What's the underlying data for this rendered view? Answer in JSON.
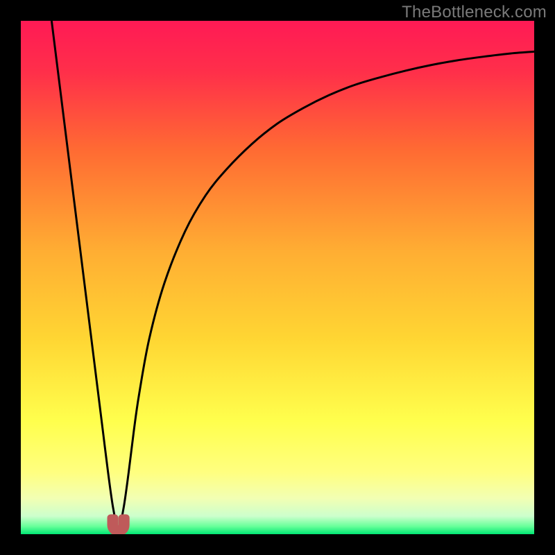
{
  "watermark": "TheBottleneck.com",
  "colors": {
    "frame": "#000000",
    "gradient_top": "#ff1a4d",
    "gradient_mid_upper": "#ff6a33",
    "gradient_mid": "#ffd633",
    "gradient_lower": "#ffff66",
    "gradient_pale": "#f2ffcc",
    "gradient_bottom": "#00e673",
    "curve": "#000000",
    "marker_fill": "#bf5a5a",
    "marker_stroke": "#bf5a5a"
  },
  "chart_data": {
    "type": "line",
    "title": "",
    "xlabel": "",
    "ylabel": "",
    "xlim": [
      0,
      100
    ],
    "ylim": [
      0,
      100
    ],
    "optimum_x": 19,
    "series": [
      {
        "name": "bottleneck-curve",
        "x": [
          6,
          8,
          10,
          12,
          14,
          15,
          16,
          17,
          18,
          19,
          20,
          21,
          22,
          23,
          25,
          28,
          32,
          36,
          40,
          45,
          50,
          55,
          60,
          65,
          70,
          75,
          80,
          85,
          90,
          95,
          100
        ],
        "y": [
          100,
          84,
          68,
          52,
          36,
          28,
          20,
          12,
          5,
          1,
          5,
          12,
          20,
          27,
          38,
          49,
          59,
          66,
          71,
          76,
          80,
          83,
          85.5,
          87.5,
          89,
          90.3,
          91.4,
          92.3,
          93,
          93.6,
          94
        ]
      }
    ],
    "marker": {
      "name": "optimum-marker",
      "shape": "U",
      "x_range": [
        17.5,
        20.5
      ],
      "y": 1.5
    }
  }
}
